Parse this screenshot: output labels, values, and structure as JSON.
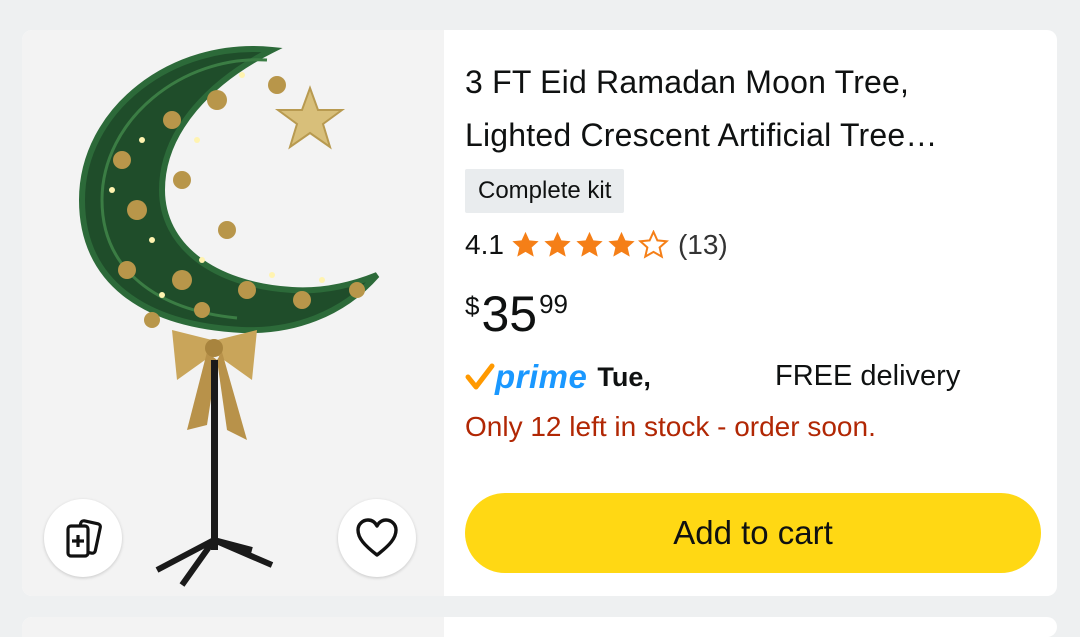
{
  "product": {
    "title_line1": "3 FT Eid Ramadan Moon Tree,",
    "title_line2": "Lighted Crescent Artificial Tree…",
    "badge": "Complete kit",
    "rating": "4.1",
    "stars_filled": 4,
    "stars_total": 5,
    "review_count": "(13)",
    "price": {
      "symbol": "$",
      "whole": "35",
      "fraction": "99"
    },
    "delivery": {
      "prime_label": "prime",
      "day": "Tue,",
      "free_text": "FREE delivery"
    },
    "stock_message": "Only 12 left in stock - order soon.",
    "add_to_cart_label": "Add to cart"
  },
  "icons": {
    "compare": "compare-cards-icon",
    "wishlist": "heart-icon",
    "prime_check": "prime-check-icon",
    "star": "star-icon"
  },
  "colors": {
    "price_text": "#0f1111",
    "stock_red": "#b12704",
    "prime_blue": "#1a98ff",
    "prime_orange": "#f90",
    "cart_yellow": "#ffd814",
    "star_orange": "#f57f17"
  }
}
